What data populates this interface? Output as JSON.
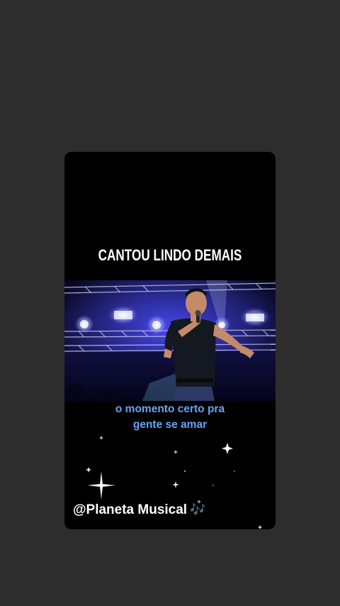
{
  "card": {
    "title": "CANTOU LINDO DEMAIS",
    "lyrics": {
      "line1": "o momento certo pra",
      "line2": "gente se amar"
    },
    "handle": "@Planeta Musical",
    "handle_icon": "music-notes-icon",
    "handle_icon_glyph": "🎶"
  },
  "colors": {
    "background": "#2e2d2d",
    "card": "#000000",
    "lyrics": "#6aa3f2",
    "stage_light": "#3a3cff"
  }
}
